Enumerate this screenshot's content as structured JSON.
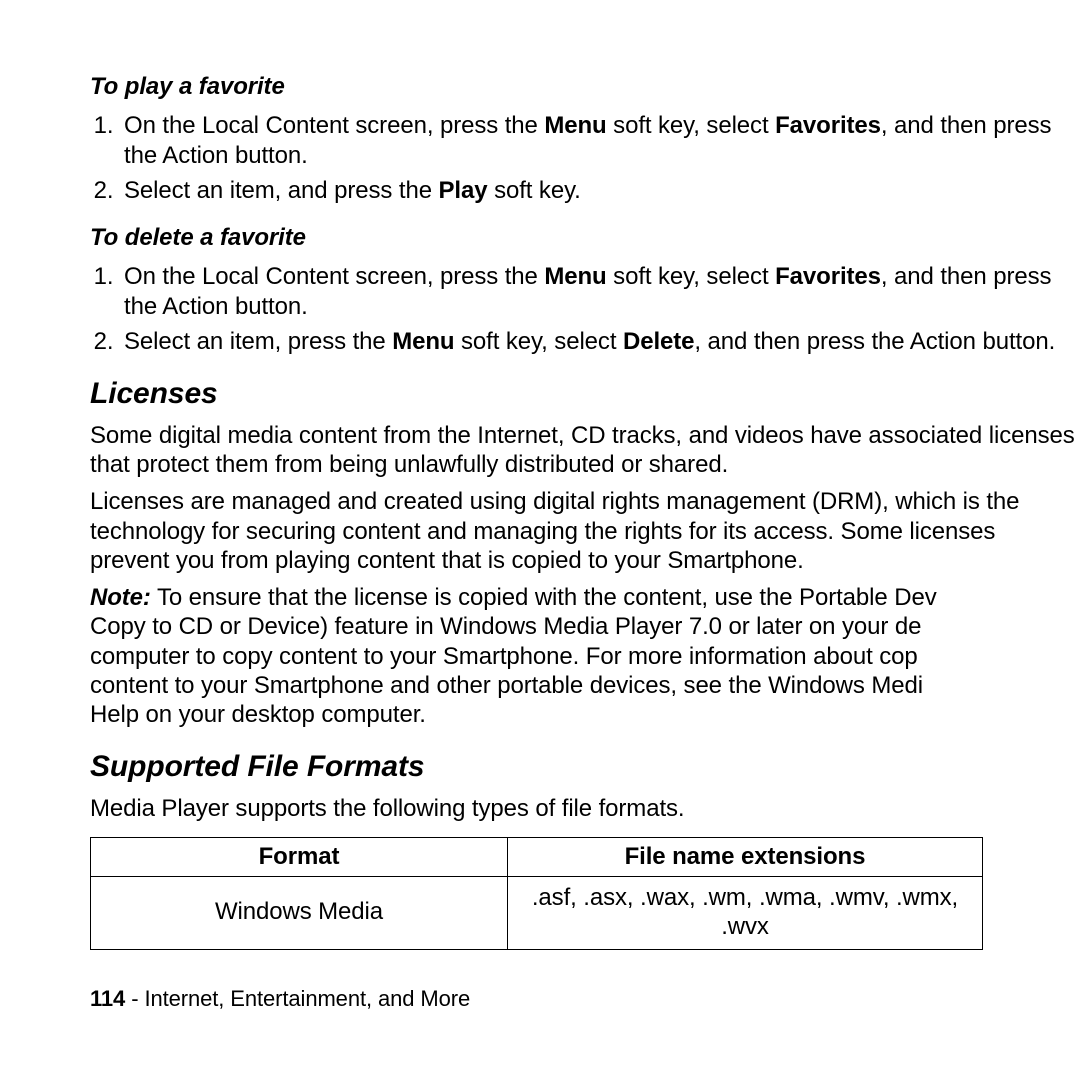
{
  "section1": {
    "heading": "To play a favorite",
    "items": {
      "0": {
        "pre1": "On the Local Content screen, press the ",
        "bold1": "Menu",
        "mid1": " soft key, select ",
        "bold2": "Favorites",
        "post1": ", and then press the Action button."
      },
      "1": {
        "pre1": "Select an item, and press the ",
        "bold1": "Play",
        "post1": " soft key."
      }
    }
  },
  "section2": {
    "heading": "To delete a favorite",
    "items": {
      "0": {
        "pre1": "On the Local Content screen, press the ",
        "bold1": "Menu",
        "mid1": " soft key, select ",
        "bold2": "Favorites",
        "post1": ", and then press the Action button."
      },
      "1": {
        "pre1": "Select an item, press the ",
        "bold1": "Menu",
        "mid1": " soft key, select ",
        "bold2": "Delete",
        "post1": ", and then press the Action button."
      }
    }
  },
  "licenses": {
    "heading": "Licenses",
    "p1": "Some digital media content from the Internet, CD tracks, and videos have associated licenses that protect them from being unlawfully distributed or shared.",
    "p2": "Licenses are managed and created using digital rights management (DRM), which is the technology for securing content and managing the rights for its access. Some licenses prevent you from playing content that is copied to your Smartphone.",
    "note_label": "Note:",
    "note_lines": {
      "0": " To ensure that the license is copied with the content, use the Portable Dev",
      "1": "Copy to CD or Device) feature in Windows Media Player 7.0 or later on your de",
      "2": "computer to copy content to your Smartphone. For more information about cop",
      "3": "content to your Smartphone and other portable devices, see the Windows Medi",
      "4": "Help on your desktop computer."
    }
  },
  "formats": {
    "heading": "Supported File Formats",
    "intro": "Media Player supports the following types of file formats.",
    "table": {
      "headers": {
        "0": "Format",
        "1": "File name extensions"
      },
      "row0": {
        "c0": "Windows Media",
        "c1_line1": ".asf, .asx, .wax, .wm, .wma, .wmv, .wmx,",
        "c1_line2": ".wvx"
      }
    }
  },
  "footer": {
    "page_no": "114",
    "sep": " - ",
    "title": "Internet, Entertainment, and More"
  }
}
